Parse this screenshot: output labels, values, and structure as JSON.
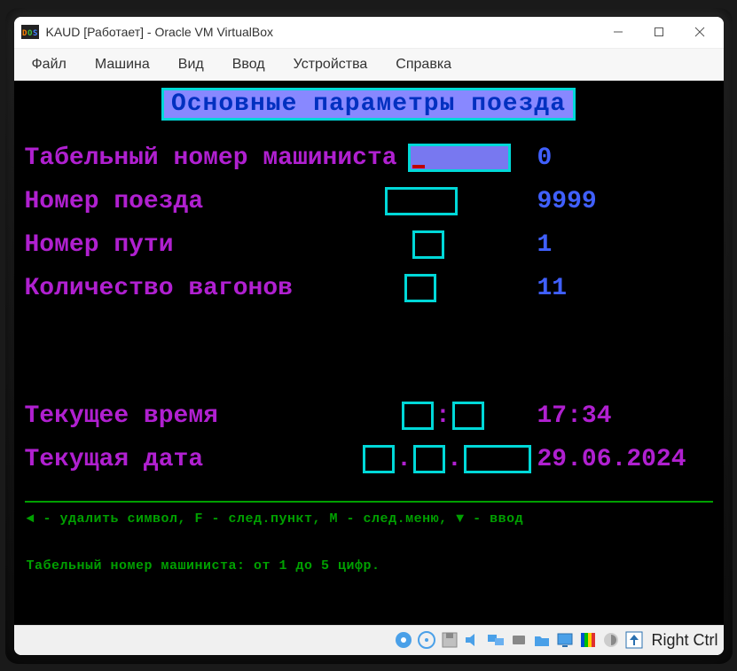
{
  "window": {
    "title": "KAUD [Работает] - Oracle VM VirtualBox"
  },
  "menubar": {
    "items": [
      "Файл",
      "Машина",
      "Вид",
      "Ввод",
      "Устройства",
      "Справка"
    ]
  },
  "dos": {
    "header": "Основные параметры поезда",
    "rows": {
      "driver_id": {
        "label": "Табельный номер машиниста",
        "value": "0"
      },
      "train_no": {
        "label": "Номер поезда",
        "value": "9999"
      },
      "track_no": {
        "label": "Номер пути",
        "value": "1"
      },
      "wagons": {
        "label": "Количество вагонов",
        "value": "11"
      },
      "time": {
        "label": "Текущее время",
        "value": "17:34"
      },
      "date": {
        "label": "Текущая дата",
        "value": "29.06.2024"
      }
    },
    "hint": "◄ - удалить символ, F - след.пункт, M - след.меню, ▼ - ввод",
    "status": "Табельный номер машиниста: от 1 до 5 цифр."
  },
  "statusbar": {
    "right_text": "Right Ctrl"
  }
}
